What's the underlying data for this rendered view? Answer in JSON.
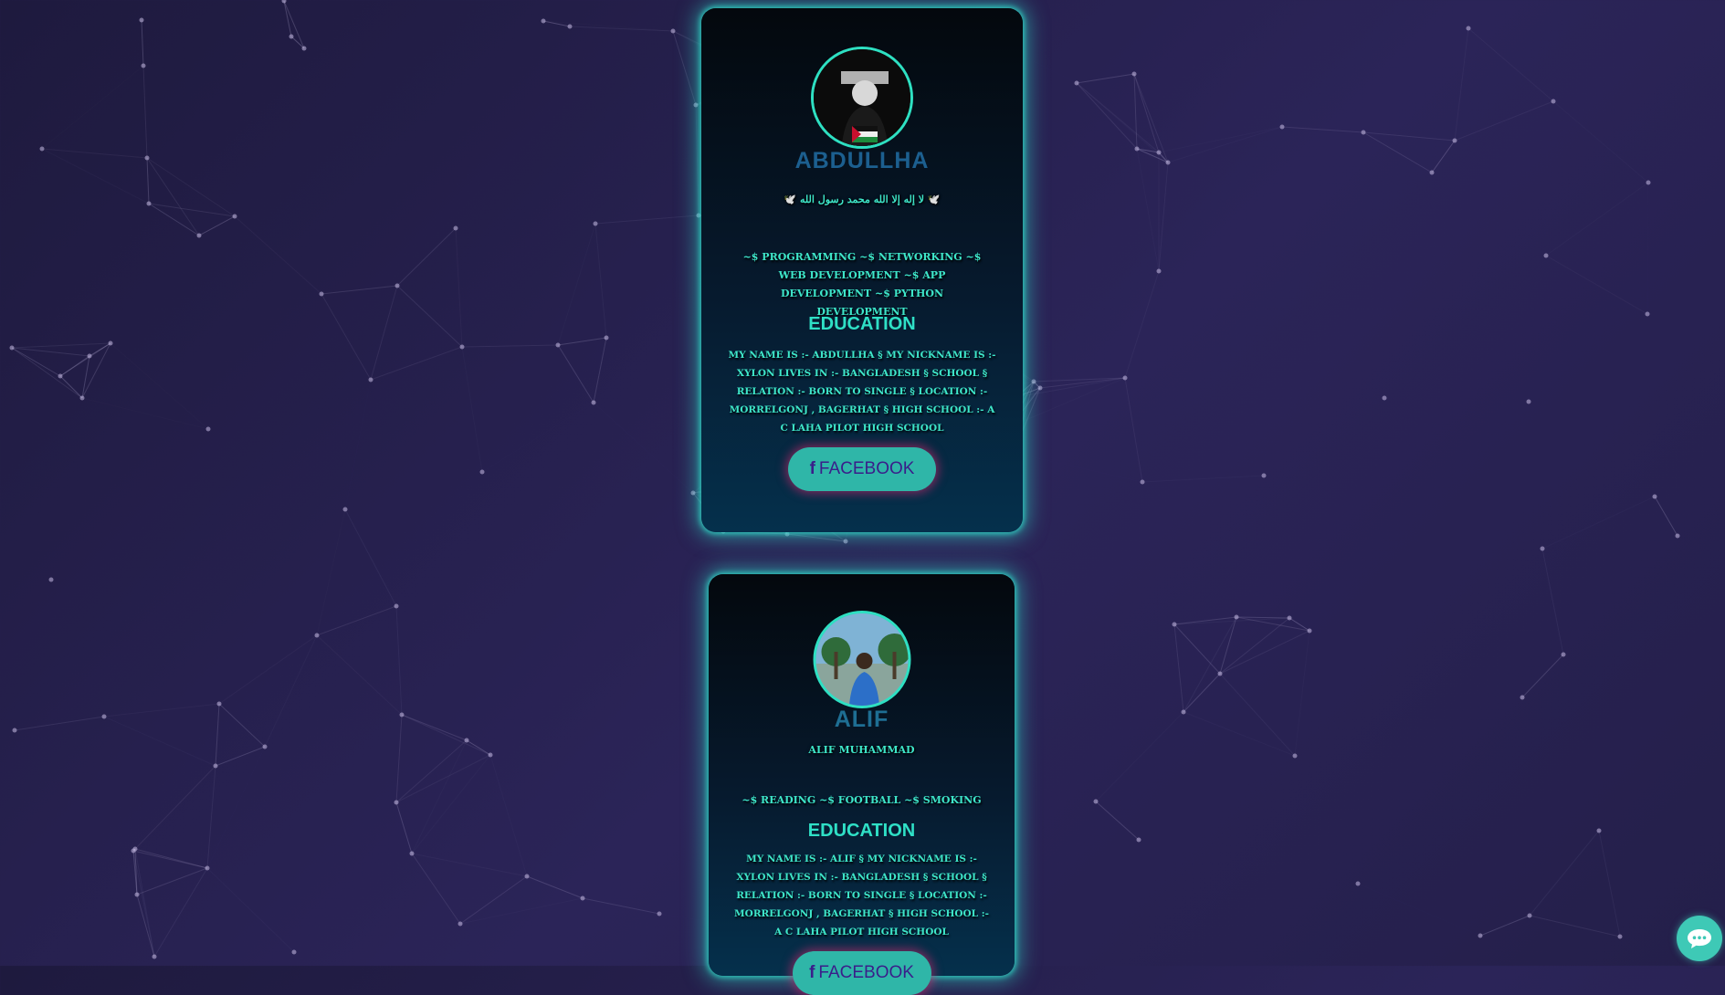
{
  "profiles": [
    {
      "name": "ABDULLHA",
      "tagline": "🕊️ لا إله إلا الله محمد رسول الله 🕊️",
      "skills": "~$ PROGRAMMING ~$ NETWORKING ~$ WEB DEVELOPMENT ~$ APP DEVELOPMENT ~$ PYTHON DEVELOPMENT",
      "education_title": "EDUCATION",
      "education_text": "MY NAME IS :- ABDULLHA § MY NICKNAME IS :- XYLON LIVES IN :- BANGLADESH § SCHOOL § RELATION :- BORN TO SINGLE § LOCATION :- MORRELGONJ , BAGERHAT § HIGH SCHOOL :- A C LAHA PILOT HIGH SCHOOL",
      "button_label": "FACEBOOK"
    },
    {
      "name": "ALIF",
      "tagline": "ALIF MUHAMMAD",
      "skills": "~$ READING ~$ FOOTBALL ~$ SMOKING",
      "education_title": "EDUCATION",
      "education_text": "MY NAME IS :- ALIF § MY NICKNAME IS :- XYLON LIVES IN :- BANGLADESH § SCHOOL § RELATION :- BORN TO SINGLE § LOCATION :- MORRELGONJ , BAGERHAT § HIGH SCHOOL :- A C LAHA PILOT HIGH SCHOOL",
      "button_label": "FACEBOOK"
    }
  ],
  "icons": {
    "facebook": "facebook-icon",
    "chat": "chat-icon"
  },
  "colors": {
    "accent": "#2ee0c2",
    "background": "#2b2458",
    "button": "#2fb6a8",
    "name": "#1c5f8f"
  }
}
